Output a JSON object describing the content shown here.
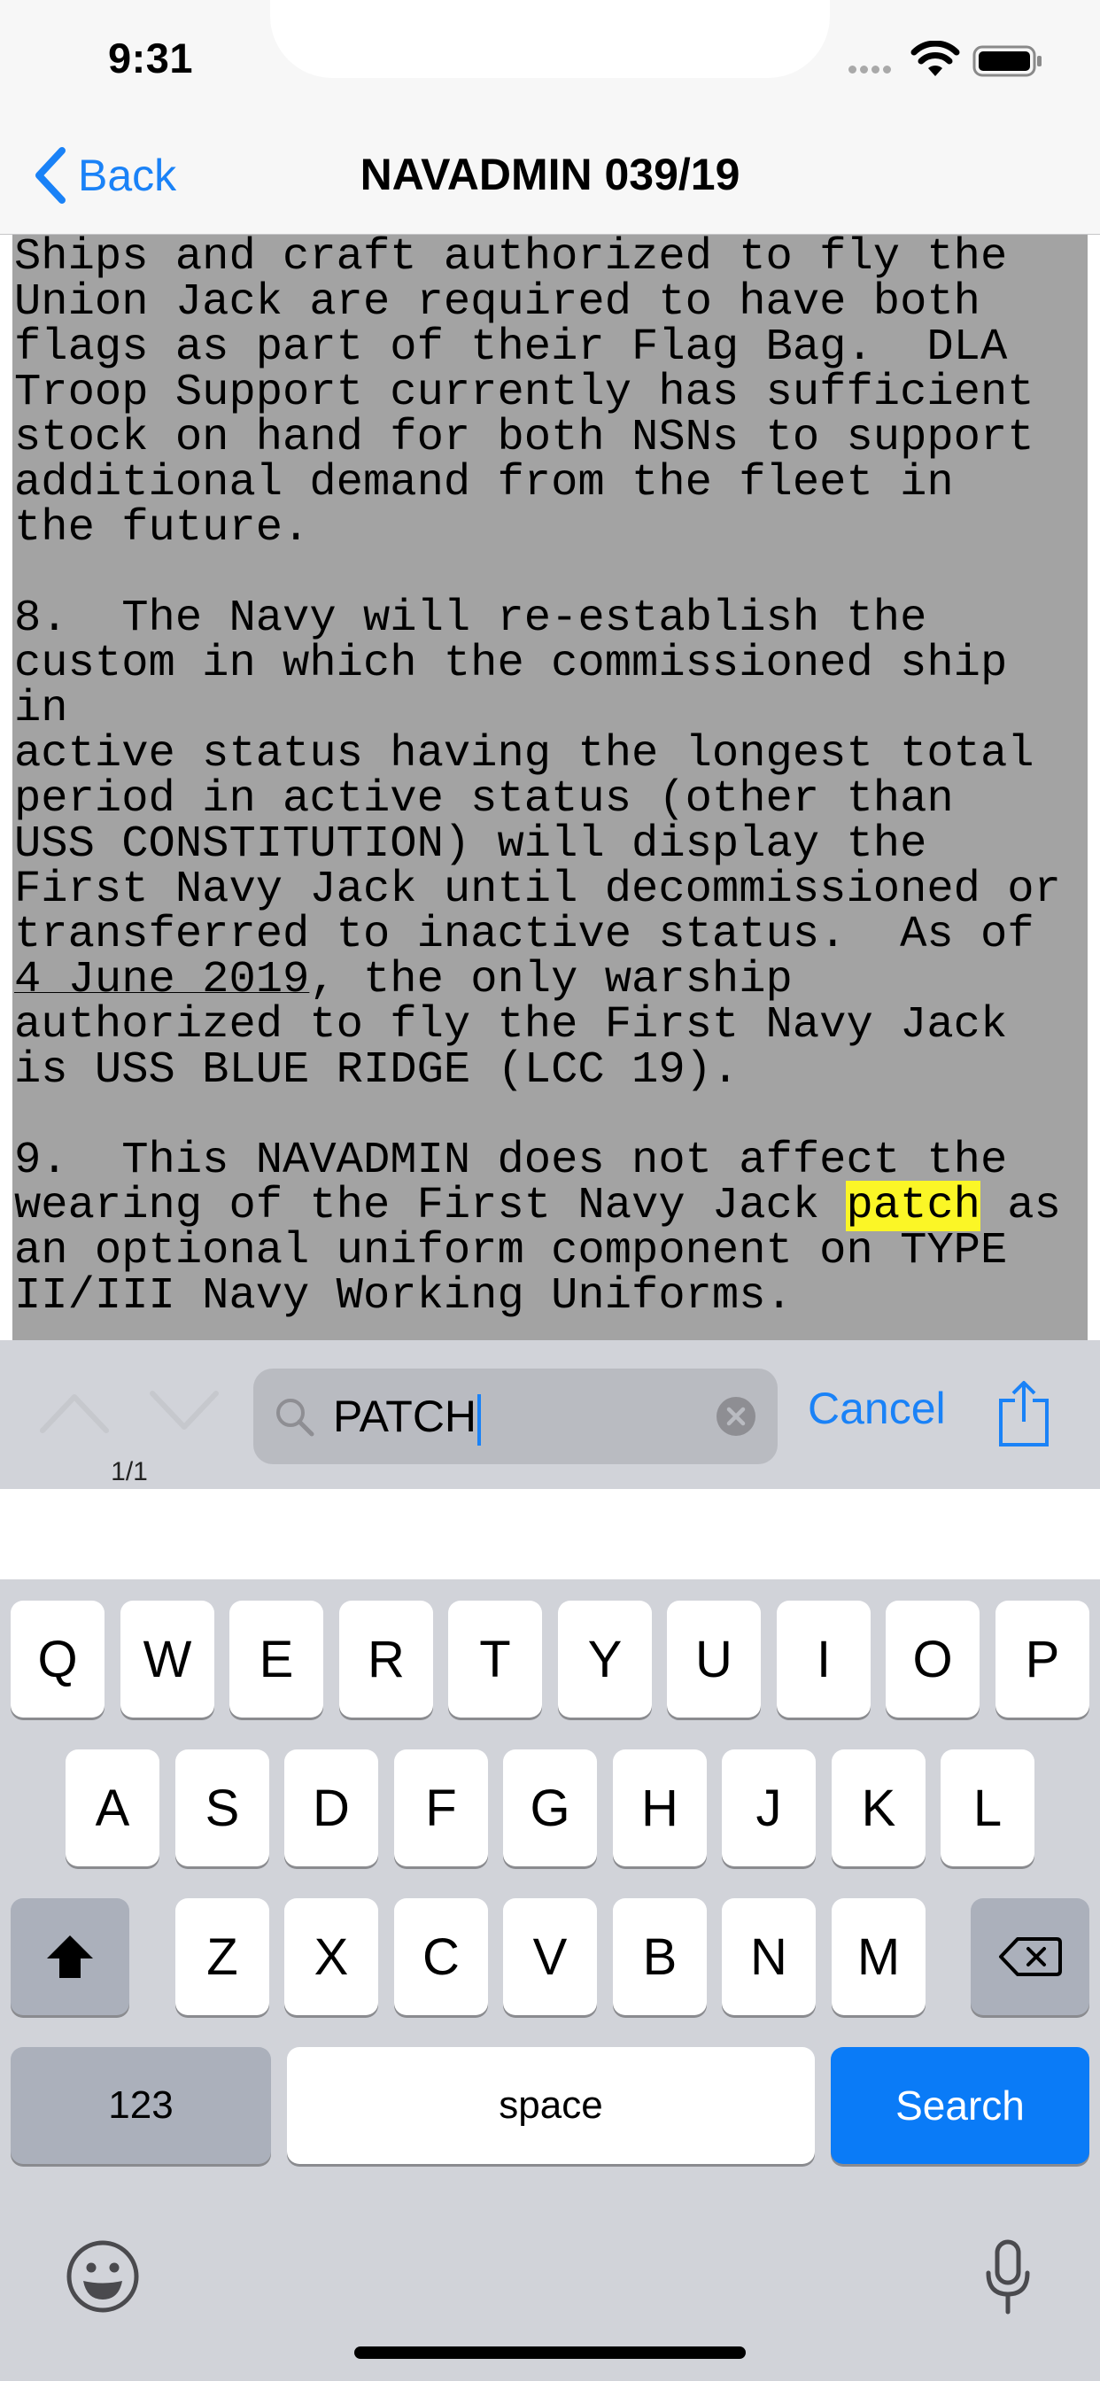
{
  "status_bar": {
    "time": "9:31"
  },
  "nav_bar": {
    "back_label": "Back",
    "title": "NAVADMIN 039/19"
  },
  "document": {
    "lines": [
      "Ships and craft authorized to fly the",
      "Union Jack are required to have both",
      "flags as part of their Flag Bag.  DLA",
      "Troop Support currently has sufficient",
      "stock on hand for both NSNs to support",
      "additional demand from the fleet in",
      "the future.",
      "",
      "8.  The Navy will re-establish the",
      "custom in which the commissioned ship",
      "in",
      "active status having the longest total",
      "period in active status (other than",
      "USS CONSTITUTION) will display the",
      "First Navy Jack until decommissioned or",
      "transferred to inactive status.  As of",
      "4 June 2019",
      ", the only warship",
      "authorized to fly the First Navy Jack",
      "is USS BLUE RIDGE (LCC 19).",
      "",
      "9.  This NAVADMIN does not affect the",
      "wearing of the First Navy Jack ",
      "patch",
      " as",
      "an optional uniform component on TYPE",
      "II/III Navy Working Uniforms."
    ]
  },
  "find_bar": {
    "match_count": "1/1",
    "search_value": "PATCH",
    "cancel_label": "Cancel"
  },
  "keyboard": {
    "row1": [
      "Q",
      "W",
      "E",
      "R",
      "T",
      "Y",
      "U",
      "I",
      "O",
      "P"
    ],
    "row2": [
      "A",
      "S",
      "D",
      "F",
      "G",
      "H",
      "J",
      "K",
      "L"
    ],
    "row3": [
      "Z",
      "X",
      "C",
      "V",
      "B",
      "N",
      "M"
    ],
    "numbers_label": "123",
    "space_label": "space",
    "search_label": "Search"
  },
  "colors": {
    "accent": "#1a82f7",
    "highlight": "#fbf626",
    "page_gray": "#a3a3a3",
    "search_key": "#0a7bf7"
  }
}
